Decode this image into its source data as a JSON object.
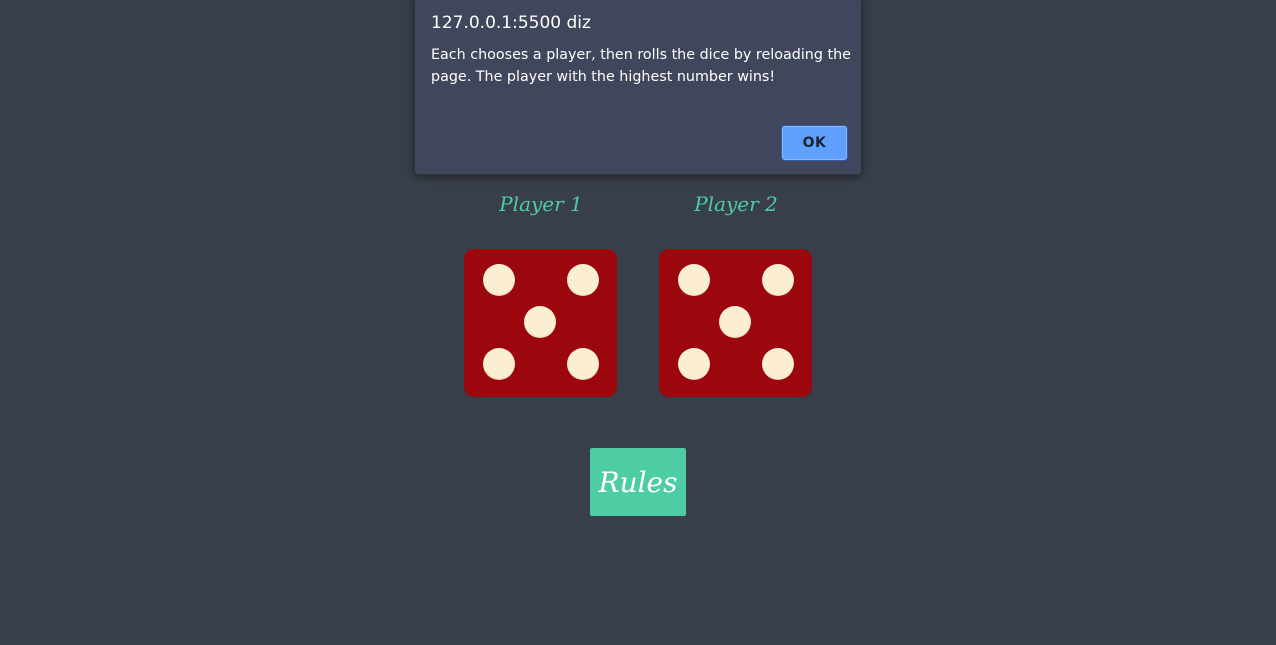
{
  "alert": {
    "origin": "127.0.0.1:5500 diz",
    "message": "Each chooses a player, then rolls the dice by reloading the page. The player with the highest number wins!",
    "ok_label": "OK"
  },
  "players": [
    {
      "title": "Player 1",
      "die_value": 5
    },
    {
      "title": "Player 2",
      "die_value": 5
    }
  ],
  "rules_button": {
    "label": "Rules"
  },
  "colors": {
    "background": "#393f4a",
    "accent": "#4ecca3",
    "die": "#9b070d",
    "pip": "#fbeed3",
    "dialog": "#40465b",
    "ok_button": "#5f9ffd"
  }
}
